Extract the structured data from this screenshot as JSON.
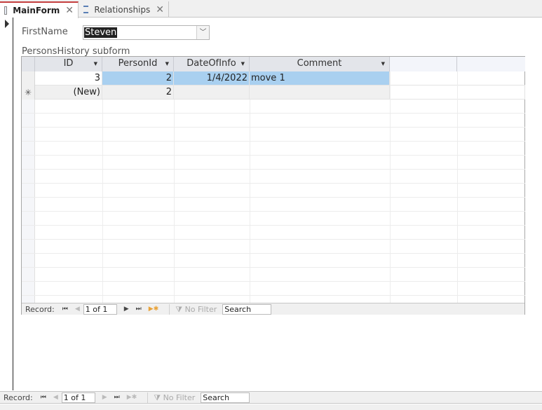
{
  "tabs": [
    {
      "label": "MainForm",
      "icon": "form-icon",
      "active": true
    },
    {
      "label": "Relationships",
      "icon": "relationships-icon",
      "active": false
    }
  ],
  "form": {
    "firstname_label": "FirstName",
    "firstname_value": "Steven",
    "subform_label": "PersonsHistory subform"
  },
  "subform": {
    "columns": [
      "ID",
      "PersonId",
      "DateOfInfo",
      "Comment"
    ],
    "rows": [
      {
        "ID": "3",
        "PersonId": "2",
        "DateOfInfo": "1/4/2022",
        "Comment": "move 1"
      }
    ],
    "new_row": {
      "ID": "(New)",
      "PersonId": "2",
      "marker": "✳"
    },
    "nav": {
      "label": "Record:",
      "position": "1 of 1",
      "filter": "No Filter",
      "search": "Search"
    }
  },
  "main_nav": {
    "label": "Record:",
    "position": "1 of 1",
    "filter": "No Filter",
    "search": "Search"
  },
  "icons": {
    "close": "✕",
    "dropdown": "▼",
    "first": "⏮",
    "prev": "◀",
    "next": "▶",
    "last": "⏭",
    "new": "▶✱"
  }
}
